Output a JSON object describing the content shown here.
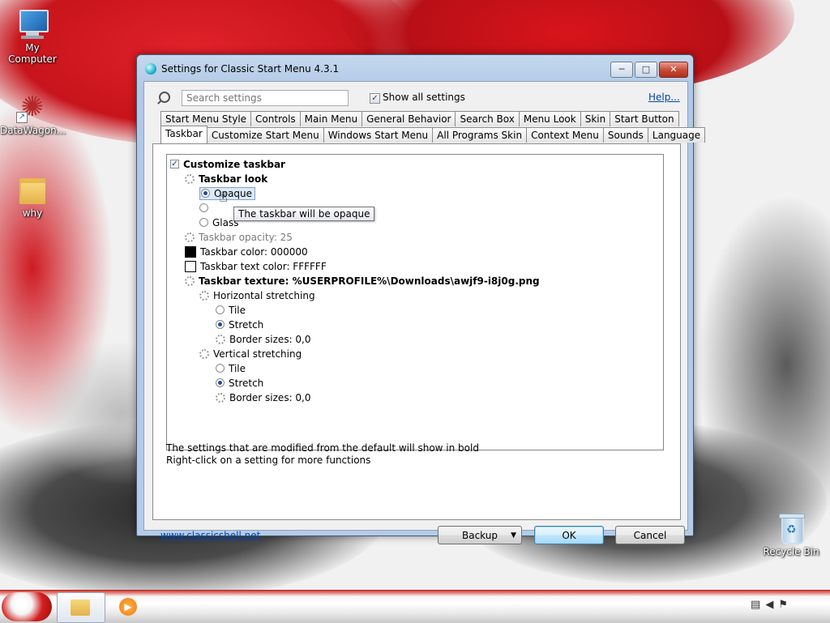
{
  "desktop": {
    "icons": [
      {
        "label": "My Computer"
      },
      {
        "label": "DataWagon..."
      },
      {
        "label": "why"
      },
      {
        "label": "Recycle Bin"
      }
    ]
  },
  "window": {
    "title": "Settings for Classic Start Menu 4.3.1",
    "caption_buttons": {
      "minimize": "─",
      "maximize": "□",
      "close": "✕"
    },
    "search": {
      "placeholder": "Search settings",
      "value": ""
    },
    "show_all": {
      "label": "Show all settings",
      "checked": true
    },
    "help_label": "Help...",
    "tabs_row1": [
      "Start Menu Style",
      "Controls",
      "Main Menu",
      "General Behavior",
      "Search Box",
      "Menu Look",
      "Skin",
      "Start Button"
    ],
    "tabs_row2": [
      "Taskbar",
      "Customize Start Menu",
      "Windows Start Menu",
      "All Programs Skin",
      "Context Menu",
      "Sounds",
      "Language"
    ],
    "active_tab": "Taskbar",
    "tree": {
      "customize_taskbar": "Customize taskbar",
      "taskbar_look": "Taskbar look",
      "opaque": "Opaque",
      "glass": "Glass",
      "tooltip": "The taskbar will be opaque",
      "taskbar_opacity": "Taskbar opacity: 25",
      "taskbar_color": "Taskbar color: 000000",
      "taskbar_text_color": "Taskbar text color: FFFFFF",
      "taskbar_texture": "Taskbar texture: %USERPROFILE%\\Downloads\\awjf9-i8j0g.png",
      "horizontal_stretching": "Horizontal stretching",
      "vertical_stretching": "Vertical stretching",
      "tile": "Tile",
      "stretch": "Stretch",
      "border_sizes": "Border sizes: 0,0"
    },
    "colors": {
      "taskbar_color": "#000000",
      "taskbar_text_color": "#FFFFFF"
    },
    "notes": [
      "The settings that are modified from the default will show in bold",
      "Right-click on a setting for more functions"
    ],
    "website": "www.classicshell.net",
    "buttons": {
      "backup": "Backup",
      "ok": "OK",
      "cancel": "Cancel"
    }
  }
}
